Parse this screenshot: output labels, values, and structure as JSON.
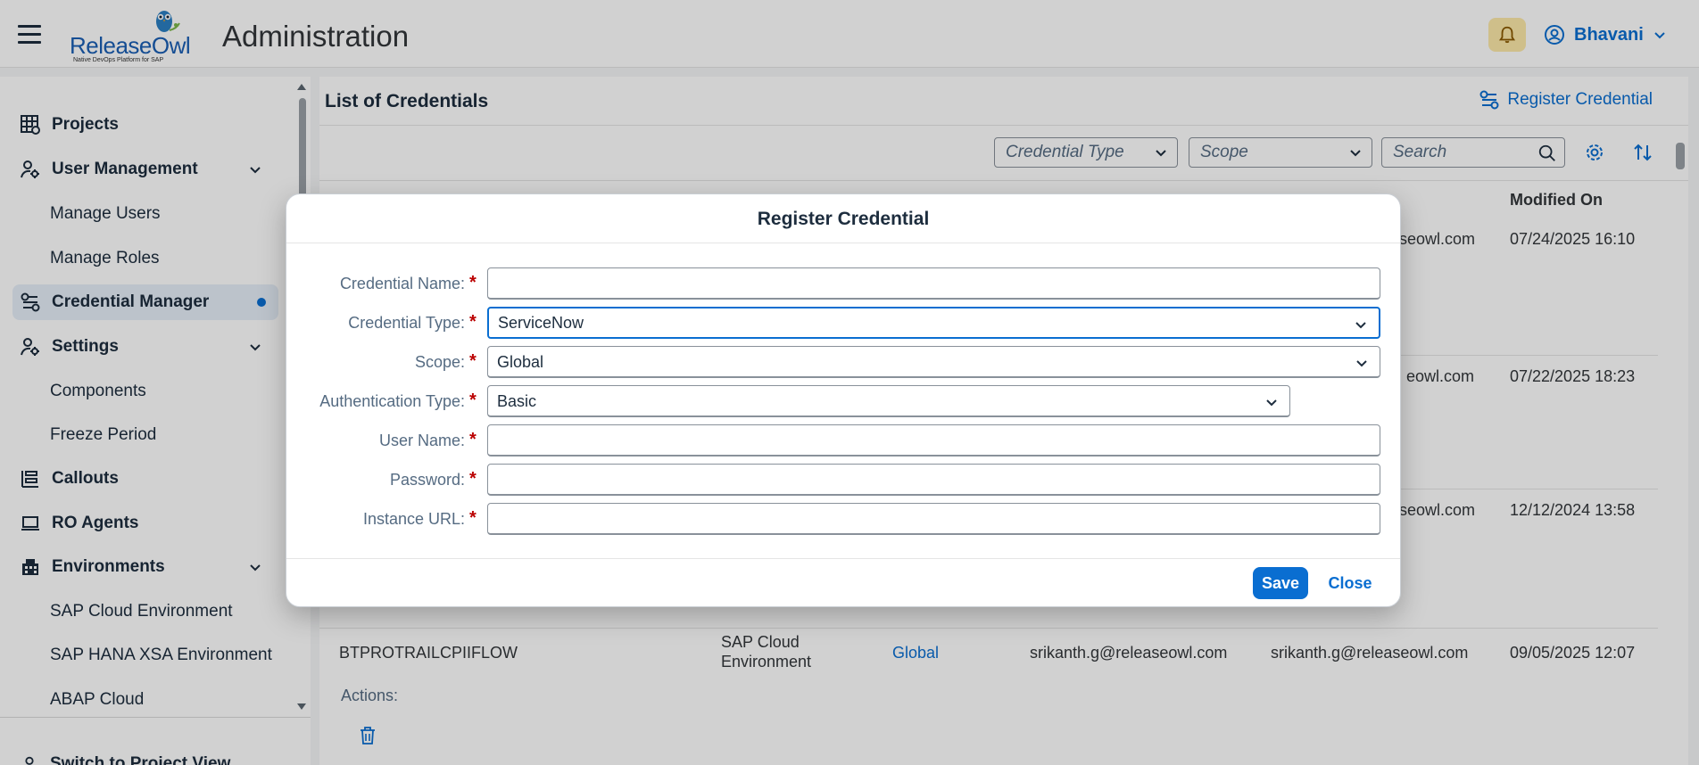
{
  "app": {
    "logo_text": "ReleaseOwl",
    "logo_tagline": "Native DevOps Platform for SAP",
    "title": "Administration",
    "user_name": "Bhavani"
  },
  "sidebar": {
    "items": [
      {
        "label": "Projects",
        "icon": "grid-gear-icon"
      },
      {
        "label": "User Management",
        "icon": "user-settings-icon",
        "expanded": true
      },
      {
        "label": "Manage Users"
      },
      {
        "label": "Manage Roles"
      },
      {
        "label": "Credential Manager",
        "icon": "credential-flow-icon",
        "active": true
      },
      {
        "label": "Settings",
        "icon": "user-settings-icon",
        "expanded": true
      },
      {
        "label": "Components"
      },
      {
        "label": "Freeze Period"
      },
      {
        "label": "Callouts",
        "icon": "callouts-icon"
      },
      {
        "label": "RO Agents",
        "icon": "laptop-icon"
      },
      {
        "label": "Environments",
        "icon": "building-icon",
        "expanded": true
      },
      {
        "label": "SAP Cloud Environment"
      },
      {
        "label": "SAP HANA XSA Environment"
      },
      {
        "label": "ABAP Cloud"
      }
    ],
    "switch_view": "Switch to Project View"
  },
  "main": {
    "title": "List of Credentials",
    "register_label": "Register Credential",
    "filters": {
      "credential_type_placeholder": "Credential Type",
      "scope_placeholder": "Scope",
      "search_placeholder": "Search"
    },
    "headers": {
      "modified_on": "Modified On"
    },
    "rows": [
      {
        "modified_by_partial": "seowl.com",
        "modified_on": "07/24/2025 16:10"
      },
      {
        "modified_by_partial": "eowl.com",
        "modified_on": "07/22/2025 18:23"
      },
      {
        "modified_by_partial": "seowl.com",
        "modified_on": "12/12/2024 13:58"
      },
      {
        "name": "BTPROTRAILCPIIFLOW",
        "type_line1": "SAP Cloud",
        "type_line2": "Environment",
        "scope": "Global",
        "created_by": "srikanth.g@releaseowl.com",
        "modified_by": "srikanth.g@releaseowl.com",
        "modified_on": "09/05/2025 12:07",
        "actions_label": "Actions:"
      }
    ]
  },
  "dialog": {
    "title": "Register Credential",
    "fields": {
      "credential_name": {
        "label": "Credential Name:",
        "value": ""
      },
      "credential_type": {
        "label": "Credential Type:",
        "value": "ServiceNow"
      },
      "scope": {
        "label": "Scope:",
        "value": "Global"
      },
      "auth_type": {
        "label": "Authentication Type:",
        "value": "Basic"
      },
      "user_name": {
        "label": "User Name:",
        "value": ""
      },
      "password": {
        "label": "Password:",
        "value": ""
      },
      "instance_url": {
        "label": "Instance URL:",
        "value": ""
      }
    },
    "required_mark": "*",
    "save_label": "Save",
    "close_label": "Close"
  },
  "colors": {
    "accent": "#0a6ed1",
    "required": "#bb0000",
    "notification_bg": "#fde9a9"
  }
}
